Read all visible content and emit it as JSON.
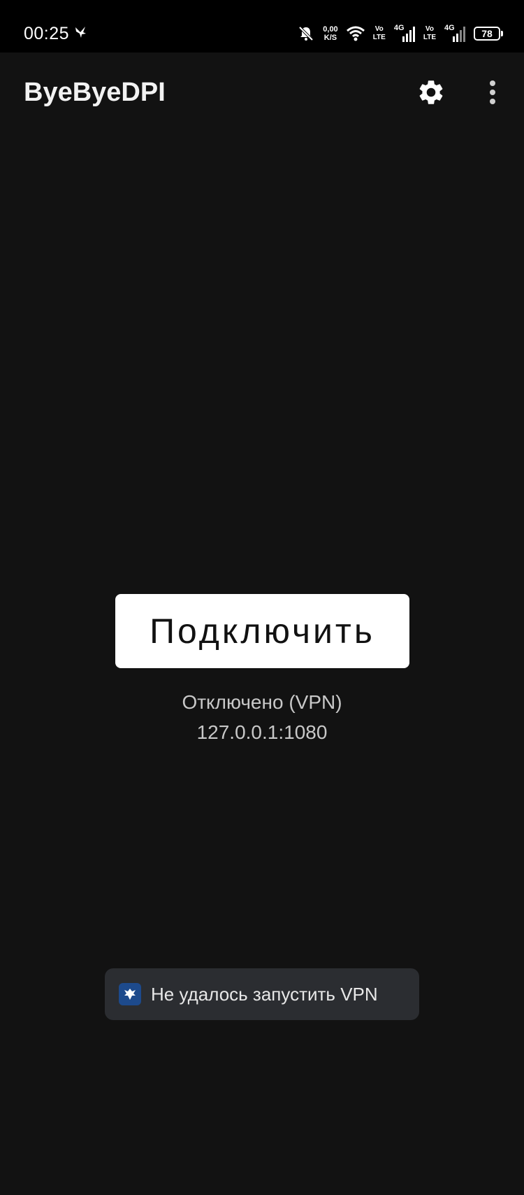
{
  "status_bar": {
    "time": "00:25",
    "net_speed_value": "0,00",
    "net_speed_unit": "K/S",
    "sim1_volte_top": "Vo",
    "sim1_volte_bottom": "LTE",
    "sim1_network": "4G",
    "sim2_volte_top": "Vo",
    "sim2_volte_bottom": "LTE",
    "sim2_network": "4G",
    "battery_level": "78",
    "icons": [
      "bird-icon",
      "bell-muted-icon",
      "wifi-icon",
      "signal-icon",
      "battery-icon"
    ]
  },
  "app_bar": {
    "title": "ByeByeDPI",
    "settings_icon": "gear-icon",
    "overflow_icon": "more-vert-icon"
  },
  "main": {
    "connect_label": "Подключить",
    "status_text": "Отключено (VPN)",
    "address": "127.0.0.1:1080"
  },
  "toast": {
    "icon": "app-icon",
    "message": "Не удалось запустить VPN"
  },
  "colors": {
    "background": "#121212",
    "status_bar": "#000000",
    "button": "#ffffff",
    "toast_bg": "#2b2d31",
    "toast_icon_bg": "#1d4a8c"
  }
}
